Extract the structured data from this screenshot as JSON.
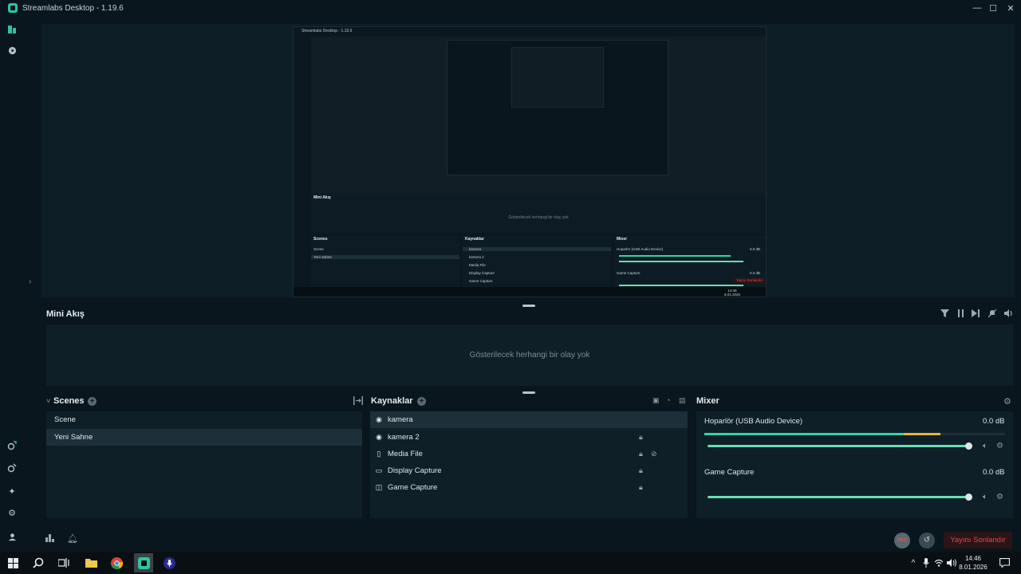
{
  "window": {
    "title": "Streamlabs Desktop - 1.19.6",
    "minimize": "—",
    "maximize": "☐",
    "close": "✕"
  },
  "nested_preview": {
    "title": "Streamlabs Desktop - 1.19.6",
    "feed_title": "Mini Akış",
    "feed_empty": "Gösterilecek herhangi bir olay yok",
    "scenes_title": "Scenes",
    "scenes": [
      "Scene",
      "Yeni Sahne"
    ],
    "sources_title": "Kaynaklar",
    "sources": [
      "kamera",
      "kamera 2",
      "Media File",
      "Display Capture",
      "Game Capture"
    ],
    "mixer_title": "Mixer",
    "mixer_items": [
      "Hoparlör (USB Audio Device)",
      "Game Capture"
    ],
    "mixer_db": "0.0 dB",
    "end_stream": "Yayını Sonlandır",
    "clock_time": "14:46",
    "clock_date": "8.01.2026"
  },
  "feed": {
    "title": "Mini Akış",
    "empty_text": "Gösterilecek herhangi bir olay yok"
  },
  "scenes": {
    "title": "Scenes",
    "collapse_glyph": "˅",
    "items": [
      {
        "label": "Scene",
        "selected": false
      },
      {
        "label": "Yeni Sahne",
        "selected": true
      }
    ]
  },
  "sources": {
    "title": "Kaynaklar",
    "items": [
      {
        "label": "kamera",
        "icon": "webcam-icon",
        "selected": true
      },
      {
        "label": "kamera 2",
        "icon": "webcam-icon",
        "selected": false
      },
      {
        "label": "Media File",
        "icon": "file-icon",
        "selected": false
      },
      {
        "label": "Display Capture",
        "icon": "monitor-icon",
        "selected": false
      },
      {
        "label": "Game Capture",
        "icon": "gamepad-icon",
        "selected": false
      }
    ]
  },
  "mixer": {
    "title": "Mixer",
    "channels": [
      {
        "name": "Hoparlör (USB Audio Device)",
        "db": "0.0 dB",
        "level": 0.8,
        "volume": 1.0
      },
      {
        "name": "Game Capture",
        "db": "0.0 dB",
        "level": 0.0,
        "volume": 1.0
      }
    ]
  },
  "bottombar": {
    "rec_label": "REC",
    "end_stream": "Yayını Sonlandır"
  },
  "taskbar": {
    "time": "14:46",
    "date": "8.01.2026"
  },
  "colors": {
    "accent": "#31c3a2",
    "meter_green": "#2fd7a6",
    "meter_yellow": "#e6b43c",
    "end_stream_red": "#e2474f"
  }
}
